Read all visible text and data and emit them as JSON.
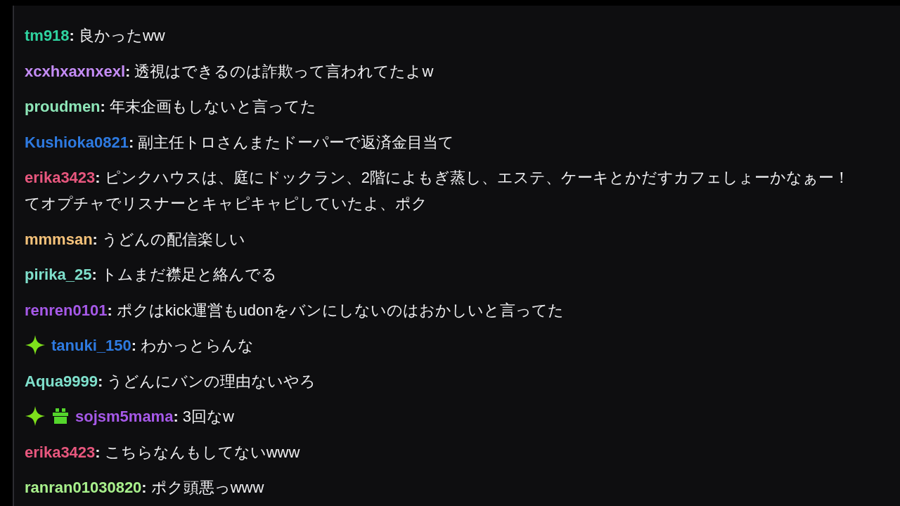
{
  "messages": [
    {
      "user": "tm918",
      "color": "#2fd3a0",
      "sep": ":",
      "text": "良かったww"
    },
    {
      "user": "xcxhxaxnxexl",
      "color": "#c48cf5",
      "sep": ":",
      "text": "透視はできるのは詐欺って言われてたよw"
    },
    {
      "user": "proudmen",
      "color": "#8ee6b8",
      "sep": ":",
      "text": "年末企画もしないと言ってた"
    },
    {
      "user": "Kushioka0821",
      "color": "#2e7ae0",
      "sep": ":",
      "text": "副主任トロさんまたドーパーで返済金目当て"
    },
    {
      "user": "erika3423",
      "color": "#e8577e",
      "sep": ":",
      "text": "ピンクハウスは、庭にドックラン、2階によもぎ蒸し、エステ、ケーキとかだすカフェしょーかなぁー！",
      "text_continued": "てオプチャでリスナーとキャピキャピしていたよ、ポク"
    },
    {
      "user": "mmmsan",
      "color": "#f5c27a",
      "sep": ":",
      "text": "うどんの配信楽しい"
    },
    {
      "user": "pirika_25",
      "color": "#7fe0cc",
      "sep": ":",
      "text": "トムまだ襟足と絡んでる"
    },
    {
      "user": "renren0101",
      "color": "#a659e8",
      "sep": ":",
      "text": "ポクはkick運営もudonをバンにしないのはおかしいと言ってた"
    },
    {
      "user": "tanuki_150",
      "color": "#2e7ae0",
      "sep": ":",
      "text": "わかっとらんな",
      "badges": [
        {
          "kind": "sparkle"
        }
      ]
    },
    {
      "user": "Aqua9999",
      "color": "#7fe0cc",
      "sep": ":",
      "text": "うどんにバンの理由ないやろ"
    },
    {
      "user": "sojsm5mama",
      "color": "#a659e8",
      "sep": ":",
      "text": "3回なw",
      "badges": [
        {
          "kind": "sparkle"
        },
        {
          "kind": "gift"
        }
      ]
    },
    {
      "user": "erika3423",
      "color": "#e8577e",
      "sep": ":",
      "text": "こちらなんもしてないwww"
    },
    {
      "user": "ranran01030820",
      "color": "#a8f08c",
      "sep": ":",
      "text": "ポク頭悪っwww"
    }
  ]
}
